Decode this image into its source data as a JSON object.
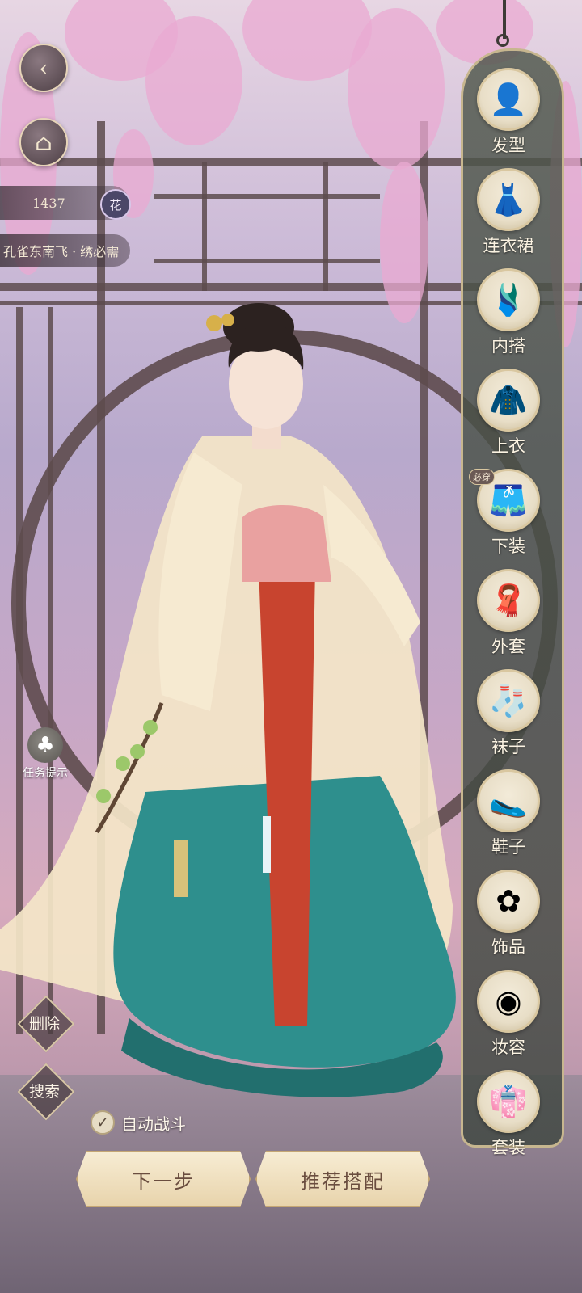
{
  "top_controls": {
    "back_icon": "back-icon",
    "home_icon": "pavilion-icon"
  },
  "currency": {
    "amount": "1437",
    "badge": "花"
  },
  "quest": {
    "title": "孔雀东南飞 · 绣必需"
  },
  "categories": [
    {
      "label": "发型",
      "icon": "hairstyle-icon"
    },
    {
      "label": "连衣裙",
      "icon": "dress-icon"
    },
    {
      "label": "内搭",
      "icon": "inner-wear-icon"
    },
    {
      "label": "上衣",
      "icon": "top-icon"
    },
    {
      "label": "下装",
      "icon": "skirt-icon",
      "tag": "必穿"
    },
    {
      "label": "外套",
      "icon": "coat-icon"
    },
    {
      "label": "袜子",
      "icon": "socks-icon"
    },
    {
      "label": "鞋子",
      "icon": "shoes-icon"
    },
    {
      "label": "饰品",
      "icon": "hairpin-icon"
    },
    {
      "label": "妆容",
      "icon": "makeup-icon"
    },
    {
      "label": "套装",
      "icon": "outfit-set-icon"
    }
  ],
  "hint": {
    "label": "任务提示",
    "icon": "clover-icon"
  },
  "actions": {
    "delete": "删除",
    "search": "搜索",
    "auto_battle": "自动战斗",
    "auto_battle_checked": true,
    "next": "下一步",
    "recommend": "推荐搭配"
  }
}
